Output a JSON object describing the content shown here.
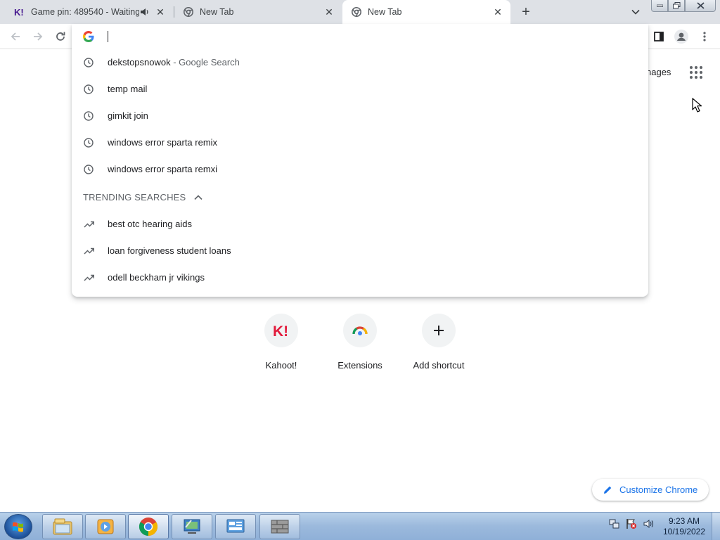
{
  "tabs": [
    {
      "title": "Game pin: 489540 - Waiting",
      "favicon": "kahoot-icon",
      "audio": true
    },
    {
      "title": "New Tab",
      "favicon": "chrome-icon"
    },
    {
      "title": "New Tab",
      "favicon": "chrome-icon",
      "active": true
    }
  ],
  "omnibox": {
    "value": "",
    "history": [
      {
        "text": "dekstopsnowok",
        "sub": " - Google Search"
      },
      {
        "text": "temp mail",
        "sub": ""
      },
      {
        "text": "gimkit join",
        "sub": ""
      },
      {
        "text": "windows error sparta remix",
        "sub": ""
      },
      {
        "text": "windows error sparta remxi",
        "sub": ""
      }
    ],
    "trending_header": "TRENDING SEARCHES",
    "trending": [
      {
        "text": "best otc hearing aids"
      },
      {
        "text": "loan forgiveness student loans"
      },
      {
        "text": "odell beckham jr vikings"
      }
    ]
  },
  "ntp": {
    "images_link": "nages",
    "shortcuts": [
      {
        "label": "Kahoot!",
        "icon": "kahoot-icon"
      },
      {
        "label": "Extensions",
        "icon": "chrome-web-store-icon"
      },
      {
        "label": "Add shortcut",
        "icon": "plus-icon"
      }
    ],
    "customize_label": "Customize Chrome"
  },
  "taskbar": {
    "time": "9:23 AM",
    "date": "10/19/2022",
    "items": [
      "file-explorer-icon",
      "media-player-icon",
      "chrome-icon",
      "control-panel-icon",
      "system-icon",
      "firewall-icon"
    ]
  },
  "colors": {
    "accent": "#1a73e8",
    "tabstrip": "#dee1e6",
    "kahoot": "#e21b3c"
  }
}
